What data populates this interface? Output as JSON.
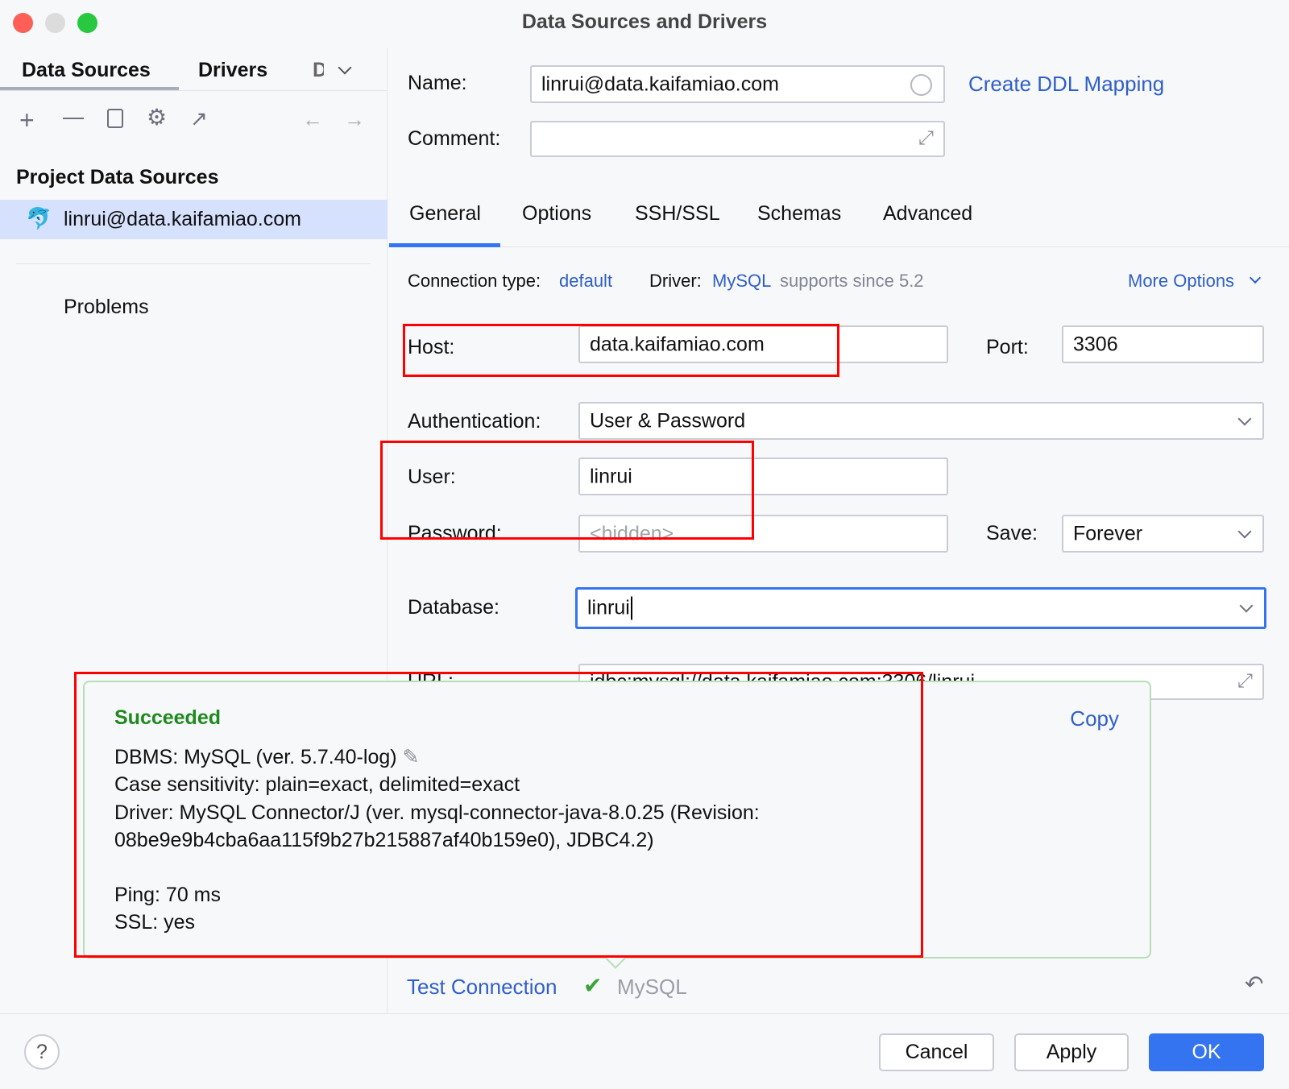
{
  "window": {
    "title": "Data Sources and Drivers"
  },
  "left": {
    "tabs": [
      {
        "label": "Data Sources",
        "active": true
      },
      {
        "label": "Drivers"
      },
      {
        "label": "D"
      }
    ],
    "toolbar": [
      "add-icon",
      "remove-icon",
      "duplicate-icon",
      "settings-icon",
      "open-external-icon",
      "back-icon",
      "forward-icon"
    ],
    "section_title": "Project Data Sources",
    "items": [
      {
        "label": "linrui@data.kaifamiao.com",
        "icon": "mysql-dolphin-icon",
        "selected": true
      }
    ],
    "problems": "Problems"
  },
  "form": {
    "name_label": "Name:",
    "name_value": "linrui@data.kaifamiao.com",
    "create_ddl": "Create DDL Mapping",
    "comment_label": "Comment:",
    "comment_value": "",
    "tabs": [
      {
        "label": "General",
        "active": true
      },
      {
        "label": "Options"
      },
      {
        "label": "SSH/SSL"
      },
      {
        "label": "Schemas"
      },
      {
        "label": "Advanced"
      }
    ],
    "conn_type_label": "Connection type:",
    "conn_type_value": "default",
    "driver_label": "Driver:",
    "driver_value": "MySQL",
    "driver_note": "supports since 5.2",
    "more_options": "More Options",
    "host_label": "Host:",
    "host_value": "data.kaifamiao.com",
    "port_label": "Port:",
    "port_value": "3306",
    "auth_label": "Authentication:",
    "auth_value": "User & Password",
    "user_label": "User:",
    "user_value": "linrui",
    "password_label": "Password:",
    "password_placeholder": "<hidden>",
    "save_label": "Save:",
    "save_value": "Forever",
    "database_label": "Database:",
    "database_value": "linrui",
    "url_label": "URL:",
    "url_value": "jdbc:mysql://data.kaifamiao.com:3306/linrui"
  },
  "popup": {
    "status": "Succeeded",
    "status_color": "#1e8a1e",
    "copy": "Copy",
    "lines": [
      "DBMS: MySQL (ver. 5.7.40-log)",
      "Case sensitivity: plain=exact, delimited=exact",
      "Driver: MySQL Connector/J (ver. mysql-connector-java-8.0.25 (Revision:",
      "08be9e9b4cba6aa115f9b27b215887af40b159e0), JDBC4.2)",
      "Ping: 70 ms",
      "SSL: yes"
    ]
  },
  "footer": {
    "test_connection": "Test Connection",
    "test_driver": "MySQL",
    "cancel": "Cancel",
    "apply": "Apply",
    "ok": "OK",
    "accent": "#3574f0"
  }
}
